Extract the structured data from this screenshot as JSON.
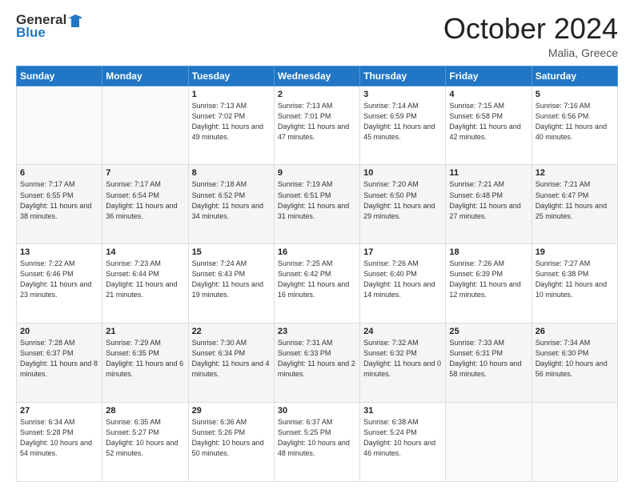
{
  "header": {
    "logo_line1": "General",
    "logo_line2": "Blue",
    "month": "October 2024",
    "location": "Malia, Greece"
  },
  "days_of_week": [
    "Sunday",
    "Monday",
    "Tuesday",
    "Wednesday",
    "Thursday",
    "Friday",
    "Saturday"
  ],
  "weeks": [
    [
      {
        "day": "",
        "info": ""
      },
      {
        "day": "",
        "info": ""
      },
      {
        "day": "1",
        "info": "Sunrise: 7:13 AM\nSunset: 7:02 PM\nDaylight: 11 hours and 49 minutes."
      },
      {
        "day": "2",
        "info": "Sunrise: 7:13 AM\nSunset: 7:01 PM\nDaylight: 11 hours and 47 minutes."
      },
      {
        "day": "3",
        "info": "Sunrise: 7:14 AM\nSunset: 6:59 PM\nDaylight: 11 hours and 45 minutes."
      },
      {
        "day": "4",
        "info": "Sunrise: 7:15 AM\nSunset: 6:58 PM\nDaylight: 11 hours and 42 minutes."
      },
      {
        "day": "5",
        "info": "Sunrise: 7:16 AM\nSunset: 6:56 PM\nDaylight: 11 hours and 40 minutes."
      }
    ],
    [
      {
        "day": "6",
        "info": "Sunrise: 7:17 AM\nSunset: 6:55 PM\nDaylight: 11 hours and 38 minutes."
      },
      {
        "day": "7",
        "info": "Sunrise: 7:17 AM\nSunset: 6:54 PM\nDaylight: 11 hours and 36 minutes."
      },
      {
        "day": "8",
        "info": "Sunrise: 7:18 AM\nSunset: 6:52 PM\nDaylight: 11 hours and 34 minutes."
      },
      {
        "day": "9",
        "info": "Sunrise: 7:19 AM\nSunset: 6:51 PM\nDaylight: 11 hours and 31 minutes."
      },
      {
        "day": "10",
        "info": "Sunrise: 7:20 AM\nSunset: 6:50 PM\nDaylight: 11 hours and 29 minutes."
      },
      {
        "day": "11",
        "info": "Sunrise: 7:21 AM\nSunset: 6:48 PM\nDaylight: 11 hours and 27 minutes."
      },
      {
        "day": "12",
        "info": "Sunrise: 7:21 AM\nSunset: 6:47 PM\nDaylight: 11 hours and 25 minutes."
      }
    ],
    [
      {
        "day": "13",
        "info": "Sunrise: 7:22 AM\nSunset: 6:46 PM\nDaylight: 11 hours and 23 minutes."
      },
      {
        "day": "14",
        "info": "Sunrise: 7:23 AM\nSunset: 6:44 PM\nDaylight: 11 hours and 21 minutes."
      },
      {
        "day": "15",
        "info": "Sunrise: 7:24 AM\nSunset: 6:43 PM\nDaylight: 11 hours and 19 minutes."
      },
      {
        "day": "16",
        "info": "Sunrise: 7:25 AM\nSunset: 6:42 PM\nDaylight: 11 hours and 16 minutes."
      },
      {
        "day": "17",
        "info": "Sunrise: 7:26 AM\nSunset: 6:40 PM\nDaylight: 11 hours and 14 minutes."
      },
      {
        "day": "18",
        "info": "Sunrise: 7:26 AM\nSunset: 6:39 PM\nDaylight: 11 hours and 12 minutes."
      },
      {
        "day": "19",
        "info": "Sunrise: 7:27 AM\nSunset: 6:38 PM\nDaylight: 11 hours and 10 minutes."
      }
    ],
    [
      {
        "day": "20",
        "info": "Sunrise: 7:28 AM\nSunset: 6:37 PM\nDaylight: 11 hours and 8 minutes."
      },
      {
        "day": "21",
        "info": "Sunrise: 7:29 AM\nSunset: 6:35 PM\nDaylight: 11 hours and 6 minutes."
      },
      {
        "day": "22",
        "info": "Sunrise: 7:30 AM\nSunset: 6:34 PM\nDaylight: 11 hours and 4 minutes."
      },
      {
        "day": "23",
        "info": "Sunrise: 7:31 AM\nSunset: 6:33 PM\nDaylight: 11 hours and 2 minutes."
      },
      {
        "day": "24",
        "info": "Sunrise: 7:32 AM\nSunset: 6:32 PM\nDaylight: 11 hours and 0 minutes."
      },
      {
        "day": "25",
        "info": "Sunrise: 7:33 AM\nSunset: 6:31 PM\nDaylight: 10 hours and 58 minutes."
      },
      {
        "day": "26",
        "info": "Sunrise: 7:34 AM\nSunset: 6:30 PM\nDaylight: 10 hours and 56 minutes."
      }
    ],
    [
      {
        "day": "27",
        "info": "Sunrise: 6:34 AM\nSunset: 5:28 PM\nDaylight: 10 hours and 54 minutes."
      },
      {
        "day": "28",
        "info": "Sunrise: 6:35 AM\nSunset: 5:27 PM\nDaylight: 10 hours and 52 minutes."
      },
      {
        "day": "29",
        "info": "Sunrise: 6:36 AM\nSunset: 5:26 PM\nDaylight: 10 hours and 50 minutes."
      },
      {
        "day": "30",
        "info": "Sunrise: 6:37 AM\nSunset: 5:25 PM\nDaylight: 10 hours and 48 minutes."
      },
      {
        "day": "31",
        "info": "Sunrise: 6:38 AM\nSunset: 5:24 PM\nDaylight: 10 hours and 46 minutes."
      },
      {
        "day": "",
        "info": ""
      },
      {
        "day": "",
        "info": ""
      }
    ]
  ]
}
